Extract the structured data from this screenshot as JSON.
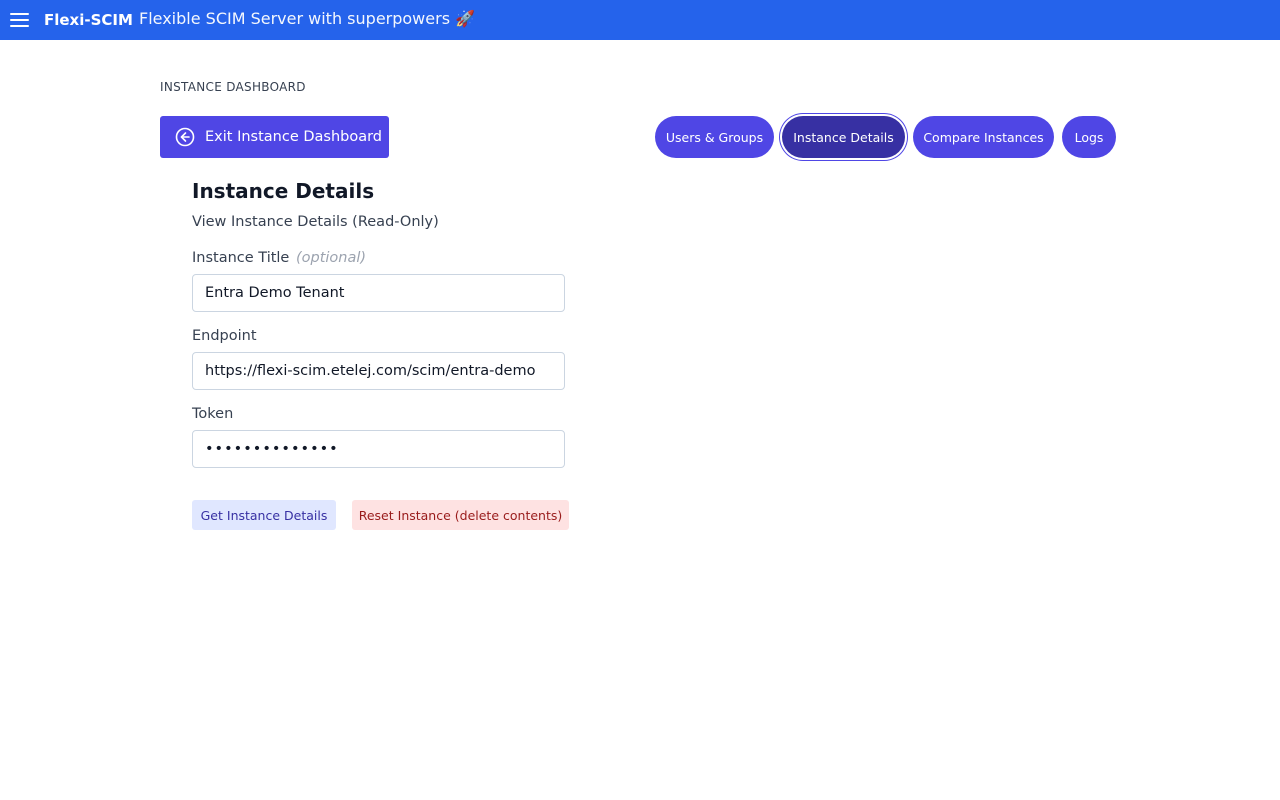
{
  "header": {
    "brand": "Flexi-SCIM",
    "tagline": "Flexible SCIM Server with superpowers 🚀",
    "menu_icon": "hamburger-menu-icon",
    "bar_color": "#2563eb"
  },
  "breadcrumb": "INSTANCE DASHBOARD",
  "exit_button": {
    "label": "Exit Instance Dashboard",
    "icon": "arrow-left-circle-icon"
  },
  "nav": {
    "tabs": [
      {
        "label": "Users & Groups",
        "active": false
      },
      {
        "label": "Instance Details",
        "active": true
      },
      {
        "label": "Compare Instances",
        "active": false
      },
      {
        "label": "Logs",
        "active": false
      }
    ],
    "accent_color": "#4f46e5"
  },
  "main": {
    "title": "Instance Details",
    "subtitle": "View Instance Details (Read-Only)",
    "fields": {
      "title": {
        "label": "Instance Title",
        "optional_note": "(optional)",
        "value": "Entra Demo Tenant"
      },
      "endpoint": {
        "label": "Endpoint",
        "value": "https://flexi-scim.etelej.com/scim/entra-demo"
      },
      "token": {
        "label": "Token",
        "value": "••••••••••••••"
      }
    },
    "actions": {
      "get_label": "Get Instance Details",
      "reset_label": "Reset Instance (delete contents)"
    }
  }
}
